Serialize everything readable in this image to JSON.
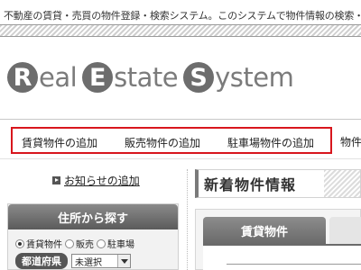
{
  "header": {
    "tagline": "不動産の賃貸・売買の物件登録・検索システム。このシステムで物件情報の検索・新",
    "logo": {
      "letters": [
        "R",
        "E",
        "S"
      ],
      "words": [
        "eal",
        "state",
        "ystem"
      ],
      "color": "#6d6d6d"
    }
  },
  "nav": {
    "items": [
      "賃貸物件の追加",
      "販売物件の追加",
      "駐車場物件の追加"
    ],
    "extra": "物件",
    "highlight_color": "#d8161d"
  },
  "sidebar": {
    "notice_link": "お知らせの追加",
    "search": {
      "title": "住所から探す",
      "radios": [
        {
          "label": "賃貸物件",
          "checked": true
        },
        {
          "label": "販売",
          "checked": false
        },
        {
          "label": "駐車場",
          "checked": false
        }
      ],
      "prefecture_label": "都道府県",
      "prefecture_value": "未選択"
    }
  },
  "main": {
    "news_title": "新着物件情報",
    "tabs": [
      "賃貸物件"
    ]
  }
}
